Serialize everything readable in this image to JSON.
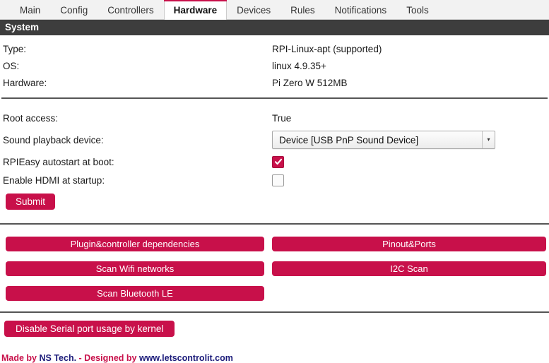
{
  "colors": {
    "accent": "#c8104a",
    "header_bar": "#3d3d3d",
    "footer_navy": "#1b1b7a"
  },
  "tabs": [
    {
      "label": "Main",
      "active": false
    },
    {
      "label": "Config",
      "active": false
    },
    {
      "label": "Controllers",
      "active": false
    },
    {
      "label": "Hardware",
      "active": true
    },
    {
      "label": "Devices",
      "active": false
    },
    {
      "label": "Rules",
      "active": false
    },
    {
      "label": "Notifications",
      "active": false
    },
    {
      "label": "Tools",
      "active": false
    }
  ],
  "section": {
    "title": "System"
  },
  "info_rows": [
    {
      "label": "Type:",
      "value": "RPI-Linux-apt (supported)"
    },
    {
      "label": "OS:",
      "value": "linux 4.9.35+"
    },
    {
      "label": "Hardware:",
      "value": "Pi Zero W 512MB"
    }
  ],
  "settings": {
    "root_access": {
      "label": "Root access:",
      "value": "True"
    },
    "sound_device": {
      "label": "Sound playback device:",
      "selected": "Device [USB PnP Sound Device]",
      "arrow": "▾"
    },
    "autostart": {
      "label": "RPIEasy autostart at boot:",
      "checked": true
    },
    "hdmi": {
      "label": "Enable HDMI at startup:",
      "checked": false
    },
    "submit_label": "Submit"
  },
  "action_buttons": [
    {
      "label": "Plugin&controller dependencies",
      "column": "left"
    },
    {
      "label": "Pinout&Ports",
      "column": "right"
    },
    {
      "label": "Scan Wifi networks",
      "column": "left"
    },
    {
      "label": "I2C Scan",
      "column": "right"
    },
    {
      "label": "Scan Bluetooth LE",
      "column": "left"
    }
  ],
  "serial_button": {
    "label": "Disable Serial port usage by kernel"
  },
  "footer": {
    "part1": "Made by ",
    "part2": "NS Tech.",
    "part3": " - Designed by ",
    "part4": "www.letscontrolit.com"
  }
}
